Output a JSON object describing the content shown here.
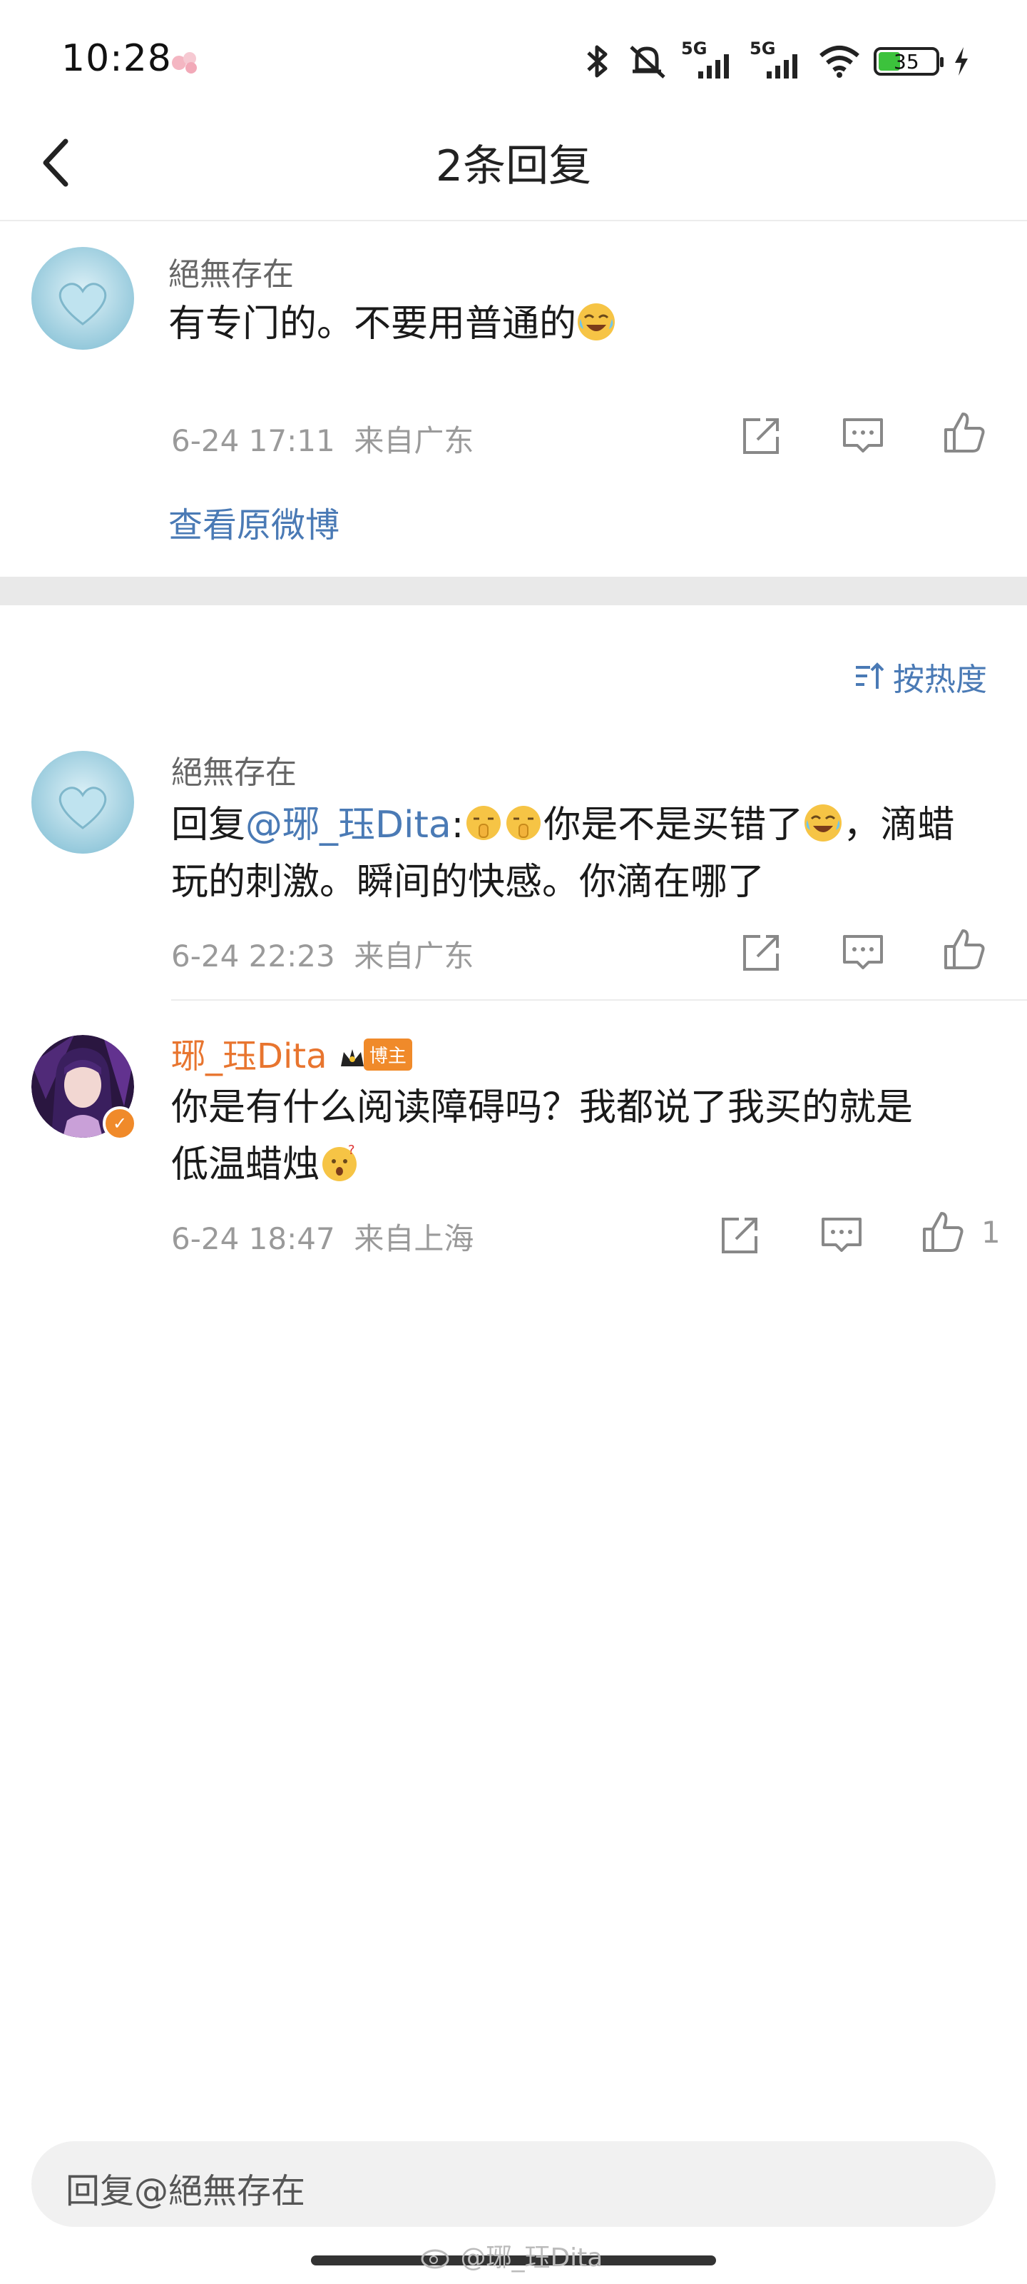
{
  "status_bar": {
    "time": "10:28",
    "battery": "35",
    "network_labels": [
      "5G",
      "5G"
    ],
    "icons": [
      "app-notification-icon",
      "bluetooth-icon",
      "mute-icon",
      "signal-5g-icon",
      "signal-5g-icon",
      "wifi-icon",
      "battery-icon",
      "charging-icon"
    ]
  },
  "header": {
    "title": "2条回复"
  },
  "original_comment": {
    "username": "絕無存在",
    "text": "有专门的。不要用普通的",
    "time": "6-24 17:11",
    "location": "来自广东",
    "view_original": "查看原微博"
  },
  "sort": {
    "label": "按热度"
  },
  "replies": [
    {
      "username": "絕無存在",
      "reply_prefix": "回复",
      "mention": "@琊_珏Dita",
      "colon": ":",
      "text_line1": "你是不是买错了",
      "text_line1b": "，滴蜡",
      "text_line2": "玩的刺激。瞬间的快感。你滴在哪了",
      "time": "6-24 22:23",
      "location": "来自广东"
    },
    {
      "username": "琊_珏Dita",
      "badge": "博主",
      "text_line1": "你是有什么阅读障碍吗？我都说了我买的就是",
      "text_line2": "低温蜡烛",
      "time": "6-24 18:47",
      "location": "来自上海",
      "like_count": "1"
    }
  ],
  "input": {
    "placeholder": "回复@絕無存在"
  },
  "watermark": "@琊_珏Dita",
  "colors": {
    "link": "#4a7ab5",
    "vip_name": "#e8752f",
    "badge": "#f08a2a"
  }
}
